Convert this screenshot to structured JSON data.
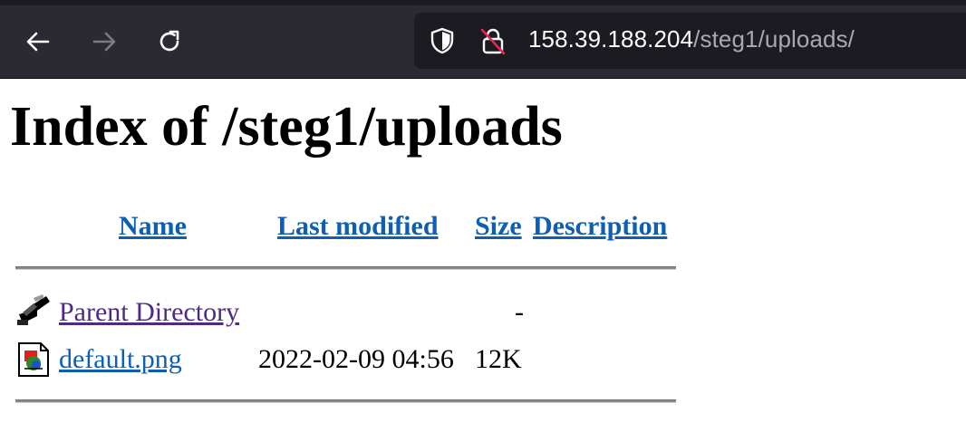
{
  "browser": {
    "url_host": "158.39.188.204",
    "url_path": "/steg1/uploads/"
  },
  "page": {
    "title": "Index of /steg1/uploads",
    "columns": {
      "name": "Name",
      "last_modified": "Last modified",
      "size": "Size",
      "description": "Description"
    },
    "rows": [
      {
        "icon": "back-folder-icon",
        "name": "Parent Directory",
        "last_modified": "",
        "size": "-",
        "description": ""
      },
      {
        "icon": "image-file-icon",
        "name": "default.png",
        "last_modified": "2022-02-09 04:56",
        "size": "12K",
        "description": ""
      }
    ]
  },
  "colors": {
    "toolbar": "#2b2a33",
    "urlbar": "#1c1b22",
    "link": "#0c5fb5",
    "visited_link": "#4f2a85"
  }
}
